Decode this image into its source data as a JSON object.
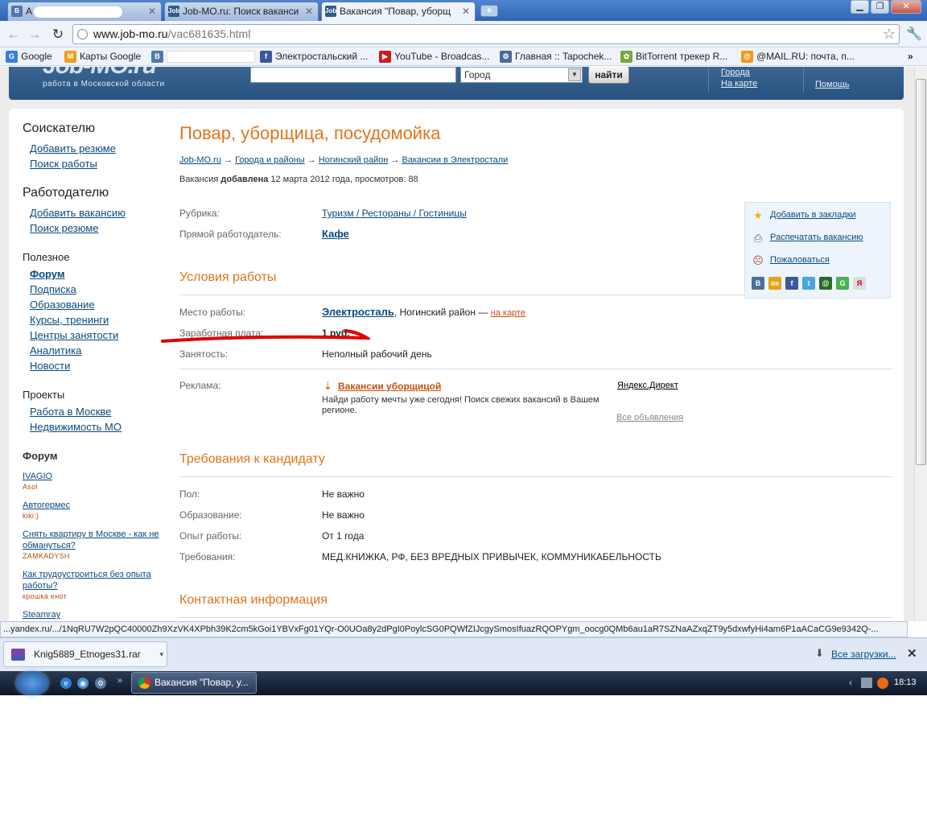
{
  "tabs": [
    {
      "label": "A",
      "icon": "В"
    },
    {
      "label": "Job-MO.ru: Поиск ваканси",
      "icon": "Job"
    },
    {
      "label": "Вакансия \"Повар, уборщ",
      "icon": "Job"
    }
  ],
  "address": {
    "host": "www.job-mo.ru",
    "path": "/vac681635.html"
  },
  "bookmarks": [
    {
      "label": "Google",
      "icon": "G"
    },
    {
      "label": "Карты Google",
      "icon": "M"
    },
    {
      "label": "",
      "icon": "В"
    },
    {
      "label": "Электростальский ...",
      "icon": "f"
    },
    {
      "label": "YouTube - Broadcas...",
      "icon": "▶"
    },
    {
      "label": "Главная :: Tapochek...",
      "icon": "⚙"
    },
    {
      "label": "BitTorrent трекер R...",
      "icon": "✿"
    },
    {
      "label": "@MAIL.RU: почта, п...",
      "icon": "@"
    }
  ],
  "site": {
    "logo": "Job-MO.ru",
    "logo_sub": "работа в Московской области",
    "city_placeholder": "Город",
    "find": "найти",
    "links": {
      "cities": "Города",
      "on_map": "На карте",
      "help": "Помощь"
    }
  },
  "left": {
    "seeker": {
      "title": "Соискателю",
      "items": [
        "Добавить резюме",
        "Поиск работы"
      ]
    },
    "employer": {
      "title": "Работодателю",
      "items": [
        "Добавить вакансию",
        "Поиск резюме"
      ]
    },
    "useful": {
      "title": "Полезное",
      "items": [
        "Форум",
        "Подписка",
        "Образование",
        "Курсы, тренинги",
        "Центры занятости",
        "Аналитика",
        "Новости"
      ]
    },
    "projects": {
      "title": "Проекты",
      "items": [
        "Работа в Москве",
        "Недвижимость МО"
      ]
    },
    "forum": {
      "title": "Форум",
      "topics": [
        {
          "title": "IVAGIO",
          "user": "Asol"
        },
        {
          "title": "Автогермес",
          "user": "kiki:)"
        },
        {
          "title": "Снять квартиру в Москве - как не обмануться?",
          "user": "ZAMKADYSH"
        },
        {
          "title": "Как трудоустроиться без опыта работы?",
          "user": "крошка енот"
        },
        {
          "title": "Steamray",
          "user": ""
        }
      ]
    }
  },
  "vacancy": {
    "title": "Повар, уборщица, посудомойка",
    "breadcrumb": [
      "Job-MO.ru",
      "Города и районы",
      "Ногинский район",
      "Вакансии в Электростали"
    ],
    "breadcrumb_sep": "→",
    "added_prefix": "Вакансия",
    "added_word": "добавлена",
    "added_suffix": "12 марта 2012 года, просмотров: 88",
    "rubric_label": "Рубрика:",
    "rubric_value": "Туризм / Рестораны / Гостиницы",
    "employer_label": "Прямой работодатель:",
    "employer_value": "Кафе",
    "conditions_title": "Условия работы",
    "place_label": "Место работы:",
    "place_city": "Электросталь",
    "place_rest": ", Ногинский район —",
    "place_map": "на карте",
    "salary_label": "Заработная плата:",
    "salary_value": "1 руб.",
    "employment_label": "Занятость:",
    "employment_value": "Неполный рабочий день",
    "ad_label": "Реклама:",
    "ad_title": "Вакансии уборщицой",
    "ad_text": "Найди работу мечты уже сегодня! Поиск свежих вакансий в Вашем регионе.",
    "ydirect": "Яндекс.Директ",
    "all_ads": "Все объявления",
    "req_title": "Требования к кандидату",
    "sex_label": "Пол:",
    "sex_value": "Не важно",
    "edu_label": "Образование:",
    "edu_value": "Не важно",
    "exp_label": "Опыт работы:",
    "exp_value": "От 1 года",
    "reqs_label": "Требования:",
    "reqs_value": "МЕД.КНИЖКА, РФ, БЕЗ ВРЕДНЫХ ПРИВЫЧЕК, КОММУНИКАБЕЛЬНОСТЬ",
    "contact_title": "Контактная информация"
  },
  "sidebox": {
    "bookmark": "Добавить в закладки",
    "print": "Распечатать вакансию",
    "complain": "Пожаловаться"
  },
  "status_url": "...yandex.ru/.../1NqRU7W2pQC40000Zh9XzVK4XPbh39K2cm5kGoi1YBVxFg01YQr-O0UOa8y2dPgI0PoylcSG0PQWfZIJcgySmosIfuazRQOPYgm_oocg0QMb6au1aR7SZNaAZxqZT9y5dxwfyHi4am6P1aACaCG9e9342Q-...",
  "download": {
    "file": "Knig5889_Etnoges31.rar",
    "all": "Все загрузки..."
  },
  "taskbar": {
    "task": "Вакансия \"Повар, у...",
    "clock": "18:13"
  },
  "colors": {
    "accent": "#e2731a",
    "link": "#0a4a7f",
    "header": "#2f5b89",
    "annotation": "#e00000"
  }
}
